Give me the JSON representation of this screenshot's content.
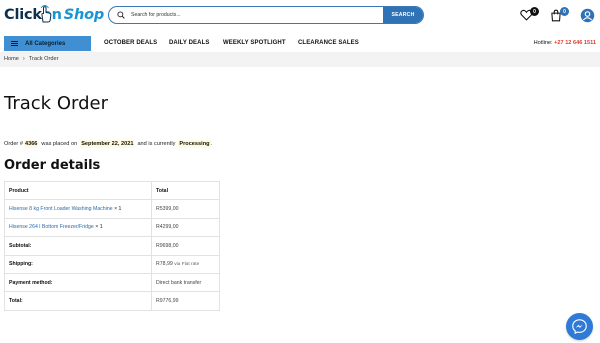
{
  "header": {
    "logo": {
      "part1": "Click ",
      "part2": "on",
      "part3": "Shop"
    },
    "search": {
      "placeholder": "Search for products...",
      "button_label": "SEARCH"
    },
    "wishlist_count": "0",
    "cart_count": "0"
  },
  "nav": {
    "all_categories_label": "All Categories",
    "items": [
      "OCTOBER DEALS",
      "DAILY DEALS",
      "WEEKLY SPOTLIGHT",
      "CLEARANCE SALES"
    ],
    "hotline_label": "Hotline:",
    "hotline_number": "+27 12 646 1511"
  },
  "breadcrumb": {
    "home": "Home",
    "separator": "›",
    "current": "Track Order"
  },
  "page": {
    "title": "Track Order",
    "notice": {
      "prefix": "Order #",
      "order_number": "4366",
      "mid1": "was placed on",
      "date": "September 22, 2021",
      "mid2": "and is currently",
      "status": "Processing",
      "suffix": "."
    },
    "details_heading": "Order details"
  },
  "order_table": {
    "headers": [
      "Product",
      "Total"
    ],
    "items": [
      {
        "name": "Hisense 8 kg Front Loader Washing Machine",
        "qty": "× 1",
        "total": "R5399,00"
      },
      {
        "name": "Hisense 264 l Bottom Freezer/Fridge",
        "qty": "× 1",
        "total": "R4299,00"
      }
    ],
    "summary": [
      {
        "label": "Subtotal:",
        "value": "R9698,00",
        "note": ""
      },
      {
        "label": "Shipping:",
        "value": "R78,99",
        "note": "via Flat rate"
      },
      {
        "label": "Payment method:",
        "value": "Direct bank transfer",
        "note": ""
      },
      {
        "label": "Total:",
        "value": "R9776,99",
        "note": ""
      }
    ]
  },
  "colors": {
    "accent": "#2f72b5",
    "hotline": "#e03a2b",
    "badge": "#111111",
    "cart_badge": "#2f72b5",
    "messenger": "#2e7ad6"
  },
  "icons": [
    "search-icon",
    "heart-icon",
    "cart-icon",
    "user-icon",
    "menu-icon",
    "messenger-icon"
  ]
}
